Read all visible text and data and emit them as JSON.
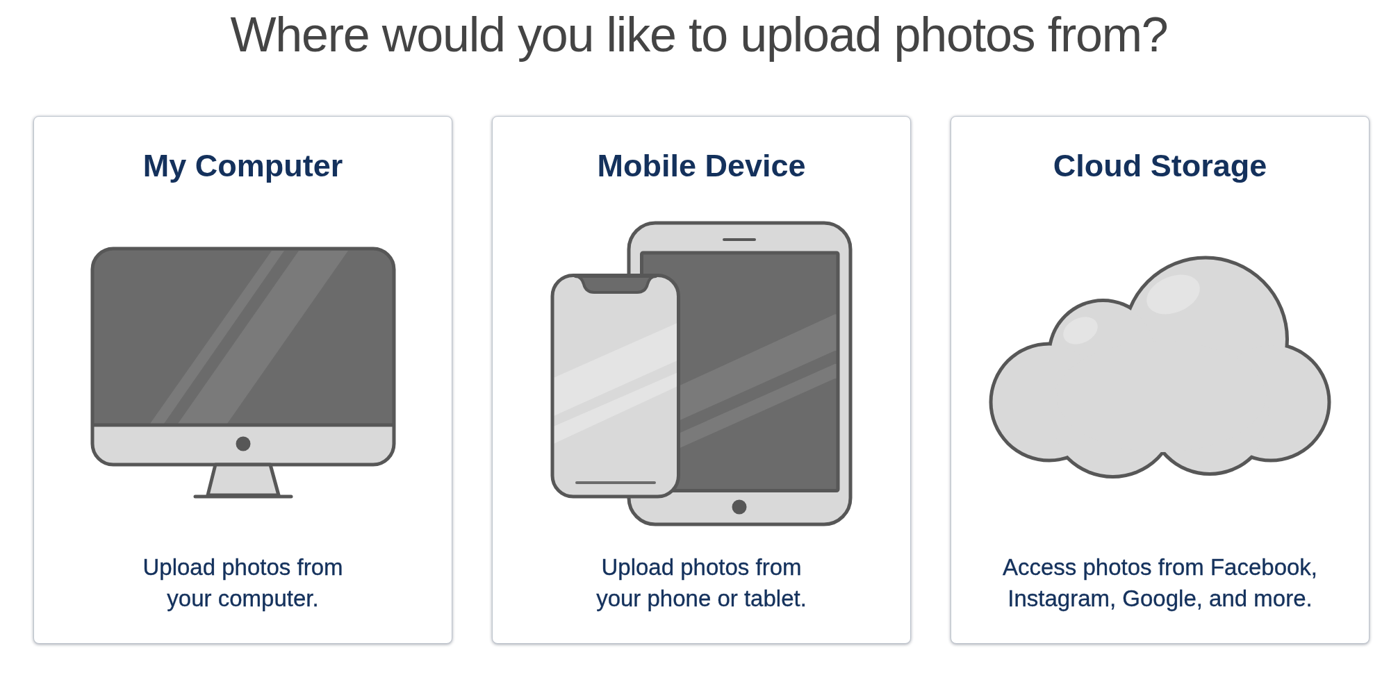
{
  "heading": "Where would you like to upload photos from?",
  "sources": [
    {
      "kind": "computer",
      "title": "My Computer",
      "description": "Upload photos from\nyour computer."
    },
    {
      "kind": "mobile",
      "title": "Mobile Device",
      "description": "Upload photos from\nyour phone or tablet."
    },
    {
      "kind": "cloud",
      "title": "Cloud Storage",
      "description": "Access photos from Facebook,\nInstagram, Google, and more."
    }
  ]
}
